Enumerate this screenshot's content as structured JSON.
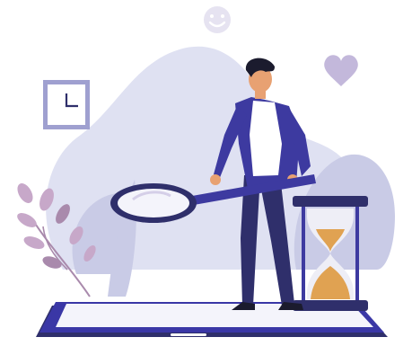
{
  "scene": {
    "kind": "flat-illustration",
    "icons": [
      "smiley-face-icon",
      "heart-icon",
      "wall-clock-icon",
      "hourglass-icon",
      "magnifying-glass-icon",
      "tablet-device-icon",
      "plant-leaves-icon"
    ],
    "colors": {
      "blob_dark": "#c9cbe6",
      "blob_light": "#dfe1f2",
      "navy": "#2f2f6b",
      "indigo": "#3d3aa0",
      "skin": "#e8a172",
      "hair": "#1b1b2e",
      "sand": "#e0a252",
      "leaf": "#c7a8c9",
      "leaf_dark": "#a98aac",
      "tablet_frame": "#3a37a6",
      "tablet_screen": "#f4f4fb",
      "accent_lilac": "#d5cfe8"
    }
  }
}
